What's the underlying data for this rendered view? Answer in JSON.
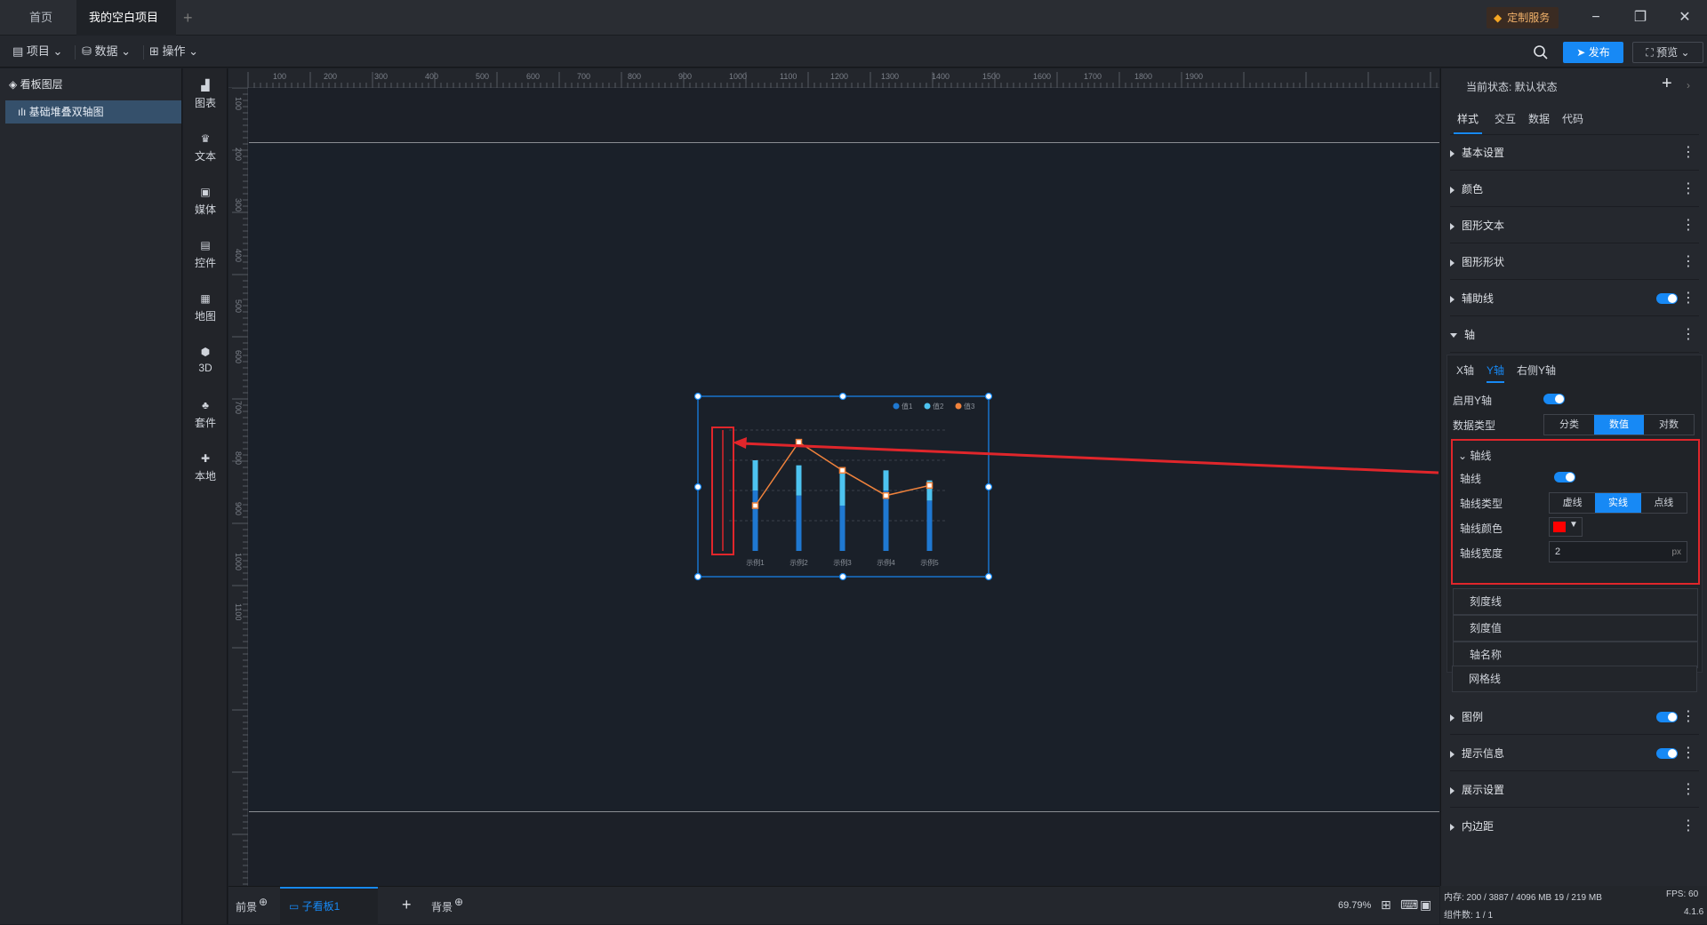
{
  "titlebar": {
    "home_tab": "首页",
    "project_tab": "我的空白项目",
    "custom_service": "定制服务"
  },
  "menubar": {
    "project": "项目",
    "data": "数据",
    "operate": "操作",
    "publish": "发布",
    "preview": "预览"
  },
  "layers": {
    "title": "看板图层",
    "item": "基础堆叠双轴图"
  },
  "tools": [
    {
      "label": "图表"
    },
    {
      "label": "文本"
    },
    {
      "label": "媒体"
    },
    {
      "label": "控件"
    },
    {
      "label": "地图"
    },
    {
      "label": "3D"
    },
    {
      "label": "套件"
    },
    {
      "label": "本地"
    }
  ],
  "ruler": {
    "top": [
      "100",
      "200",
      "300",
      "400",
      "500",
      "600",
      "700",
      "800",
      "900",
      "1000",
      "1100",
      "1200",
      "1300",
      "1400",
      "1500",
      "1600",
      "1700",
      "1800",
      "1900"
    ],
    "left": [
      "100",
      "200",
      "300",
      "400",
      "500",
      "600",
      "700",
      "800",
      "900",
      "1000",
      "1100"
    ]
  },
  "chart_data": {
    "type": "bar",
    "categories": [
      "示例1",
      "示例2",
      "示例3",
      "示例4",
      "示例5"
    ],
    "series": [
      {
        "name": "值1",
        "values": [
          60,
          55,
          45,
          60,
          50
        ]
      },
      {
        "name": "值2",
        "values": [
          30,
          30,
          35,
          20,
          20
        ]
      },
      {
        "name": "值3",
        "values": [
          45,
          108,
          80,
          55,
          65
        ]
      }
    ],
    "legend": [
      "值1",
      "值2",
      "值3"
    ],
    "colors": [
      "#1f78d1",
      "#4dc3f0",
      "#f0823c"
    ],
    "legend_position": "top-right",
    "axis_line_color": "#ff0000"
  },
  "bottom": {
    "front": "前景",
    "board_tab": "子看板1",
    "background": "背景",
    "zoom": "69.79%"
  },
  "status": {
    "memory": "内存: 200 / 3887 / 4096 MB 19 / 219 MB",
    "fps": "FPS: 60",
    "components": "组件数: 1 / 1",
    "version": "4.1.6"
  },
  "props": {
    "state_label": "当前状态: 默认状态",
    "tabs": [
      "样式",
      "交互",
      "数据",
      "代码"
    ],
    "sections": [
      "基本设置",
      "颜色",
      "图形文本",
      "图形形状",
      "辅助线",
      "轴"
    ],
    "axis_tabs": [
      "X轴",
      "Y轴",
      "右侧Y轴"
    ],
    "enable_y": "启用Y轴",
    "data_type_label": "数据类型",
    "data_types": [
      "分类",
      "数值",
      "对数"
    ],
    "axis_line_group": "轴线",
    "axis_line_label": "轴线",
    "line_type_label": "轴线类型",
    "line_types": [
      "虚线",
      "实线",
      "点线"
    ],
    "line_color_label": "轴线颜色",
    "line_color": "#ff0000",
    "line_width_label": "轴线宽度",
    "line_width": "2",
    "line_width_unit": "px",
    "sub_sections": [
      "刻度线",
      "刻度值",
      "轴名称",
      "网格线"
    ],
    "lower_sections": [
      "图例",
      "提示信息",
      "展示设置",
      "内边距"
    ]
  }
}
